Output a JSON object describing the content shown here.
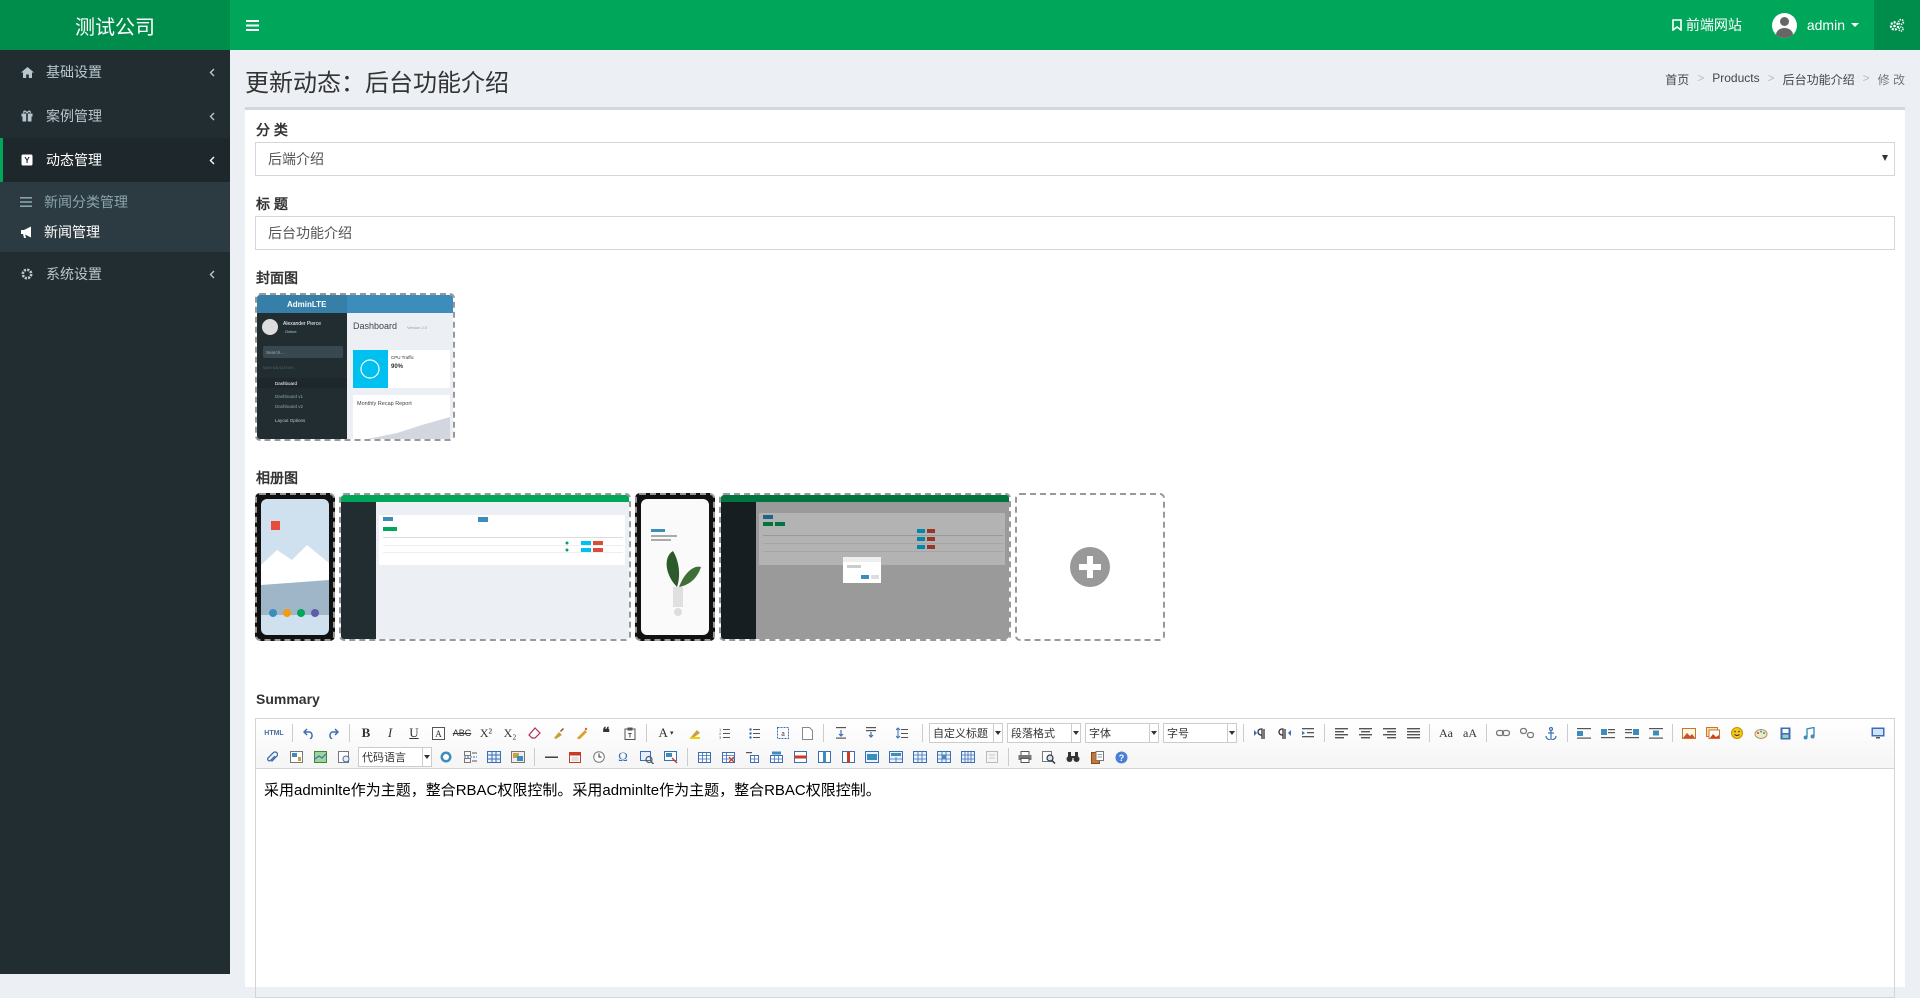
{
  "header": {
    "logo": "测试公司",
    "frontend_link": "前端网站",
    "username": "admin"
  },
  "sidebar": {
    "items": [
      {
        "label": "基础设置",
        "icon": "home-icon"
      },
      {
        "label": "案例管理",
        "icon": "gift-icon"
      },
      {
        "label": "动态管理",
        "icon": "news-icon"
      },
      {
        "label": "系统设置",
        "icon": "gear-icon"
      }
    ],
    "subitems": [
      {
        "label": "新闻分类管理",
        "icon": "list-icon"
      },
      {
        "label": "新闻管理",
        "icon": "bullhorn-icon"
      }
    ]
  },
  "page": {
    "title": "更新动态：后台功能介绍",
    "breadcrumb": [
      "首页",
      "Products",
      "后台功能介绍",
      "修 改"
    ]
  },
  "form": {
    "category_label": "分 类",
    "category_value": "后端介绍",
    "title_label": "标 题",
    "title_value": "后台功能介绍",
    "cover_label": "封面图",
    "album_label": "相册图",
    "summary_label": "Summary",
    "summary_text": "采用adminlte作为主题，整合RBAC权限控制。采用adminlte作为主题，整合RBAC权限控制。"
  },
  "cover_preview": {
    "brand": "AdminLTE",
    "user": "Alexander Pierce",
    "status": "Online",
    "search": "Search...",
    "section": "MAIN NAVIGATION",
    "menu": [
      "Dashboard",
      "Dashboard v1",
      "Dashboard v2",
      "Layout Options"
    ],
    "dash_title": "Dashboard",
    "dash_sub": "Version 2.0",
    "card_label": "CPU Traffic",
    "card_value": "90%",
    "report": "Monthly Recap Report"
  },
  "editor": {
    "html_btn": "HTML",
    "custom_title": "自定义标题",
    "paragraph": "段落格式",
    "font": "字体",
    "size": "字号",
    "code_lang": "代码语言"
  },
  "colors": {
    "brand": "#00a65a",
    "brand_dark": "#008d4c",
    "sidebar": "#222d32"
  }
}
